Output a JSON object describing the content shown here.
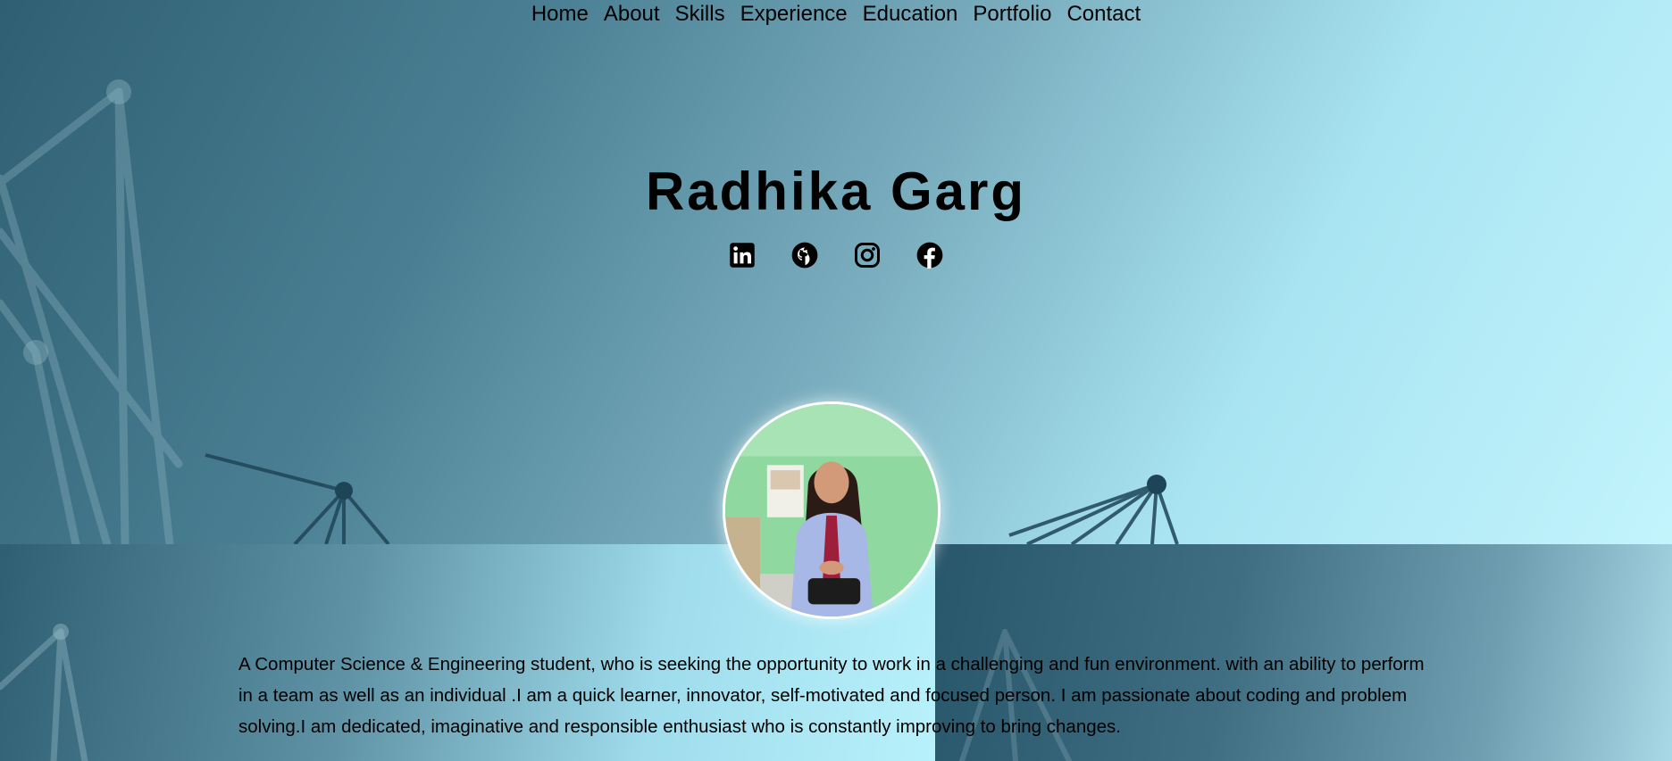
{
  "nav": {
    "items": [
      {
        "label": "Home"
      },
      {
        "label": "About"
      },
      {
        "label": "Skills"
      },
      {
        "label": "Experience"
      },
      {
        "label": "Education"
      },
      {
        "label": "Portfolio"
      },
      {
        "label": "Contact"
      }
    ]
  },
  "hero": {
    "name": "Radhika Garg",
    "socials": [
      {
        "icon": "linkedin-icon"
      },
      {
        "icon": "github-icon"
      },
      {
        "icon": "instagram-icon"
      },
      {
        "icon": "facebook-icon"
      }
    ]
  },
  "about": {
    "bio": "A Computer Science & Engineering student, who is seeking the opportunity to work in a challenging and fun environment. with an ability to perform in a team as well as an individual .I am a quick learner, innovator, self-motivated and focused person. I am passionate about coding and problem solving.I am dedicated, imaginative and responsible enthusiast who is constantly improving to bring changes."
  },
  "colors": {
    "text": "#000000",
    "hero_dark": "#2f5f72",
    "hero_light": "#c2f4fc"
  }
}
